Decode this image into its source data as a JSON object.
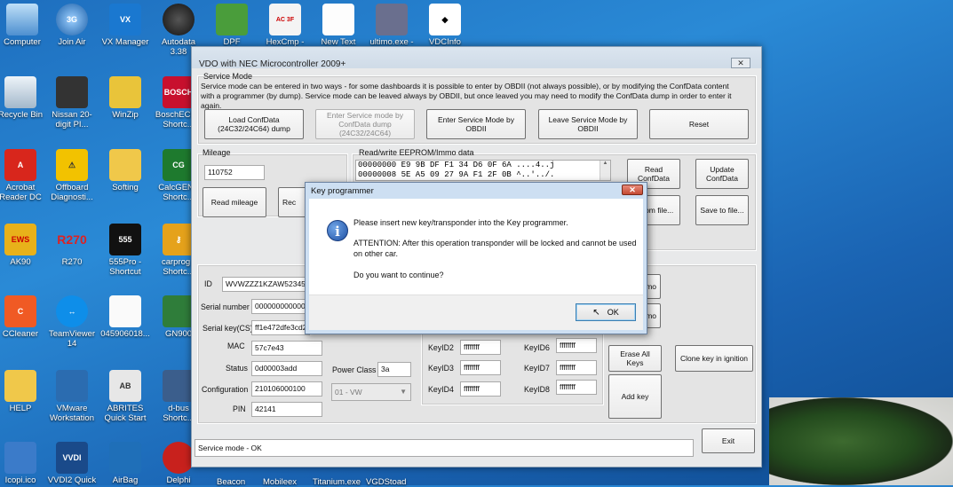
{
  "desktop": {
    "icons": [
      {
        "label": "Computer"
      },
      {
        "label": "Join Air"
      },
      {
        "label": "VX Manager"
      },
      {
        "label": "Autodata 3.38"
      },
      {
        "label": "DPF Remover"
      },
      {
        "label": "HexCmp -"
      },
      {
        "label": "New Text"
      },
      {
        "label": "ultimo.exe -"
      },
      {
        "label": "VDCInfo"
      },
      {
        "label": "Recycle Bin"
      },
      {
        "label": "Nissan 20-digit PI..."
      },
      {
        "label": "WinZip"
      },
      {
        "label": "BoschECU - Shortc..."
      },
      {
        "label": "Acrobat Reader DC"
      },
      {
        "label": "Offboard Diagnosti..."
      },
      {
        "label": "Softing"
      },
      {
        "label": "CalcGEN - Shortc..."
      },
      {
        "label": "AK90"
      },
      {
        "label": "R270"
      },
      {
        "label": "555Pro - Shortcut"
      },
      {
        "label": "carprog - Shortc..."
      },
      {
        "label": "CCleaner"
      },
      {
        "label": "TeamViewer 14"
      },
      {
        "label": "045906018..."
      },
      {
        "label": "GN900"
      },
      {
        "label": "HELP"
      },
      {
        "label": "VMware Workstation"
      },
      {
        "label": "ABRITES Quick Start"
      },
      {
        "label": "d-bus Shortc..."
      }
    ],
    "bottom_labels": [
      "Icopi.ico",
      "VVDI2 Quick",
      "AirBag",
      "Delphi",
      "Beacon",
      "Mobileex",
      "Titanium.exe",
      "VGDStoad"
    ]
  },
  "window": {
    "title": "VDO with NEC Microcontroller 2009+",
    "close": "✕",
    "service_mode": {
      "group_label": "Service Mode",
      "description": "Service mode can be entered in two ways - for some dashboards it is possible to enter by OBDII (not always possible), or by modifying the ConfData content with a programmer (by dump). Service mode can be leaved always by OBDII, but once leaved you may need to modify the ConfData dump in order to enter it again.",
      "btn_load": "Load ConfData (24C32/24C64) dump",
      "btn_enter_dump": "Enter Service mode by ConfData dump (24C32/24C64)",
      "btn_enter_obd": "Enter Service Mode by OBDII",
      "btn_leave_obd": "Leave Service Mode by OBDII",
      "btn_reset": "Reset"
    },
    "mileage": {
      "group_label": "Mileage",
      "value": "110752",
      "btn_read": "Read mileage",
      "btn_second": "Rec"
    },
    "eeprom": {
      "group_label": "Read/write EEPROM/Immo data",
      "lines": [
        "00000000 E9 9B DF F1 34 D6 0F 6A ....4..j",
        "00000008 5E A5 09 27 9A F1 2F 0B ^..'../."
      ],
      "btn_read_conf": "Read ConfData",
      "btn_update_conf": "Update ConfData",
      "btn_load_file": "d from file...",
      "btn_save_file": "Save to file..."
    },
    "immo": {
      "id_label": "ID",
      "id_value": "WVWZZZ1KZAW52345",
      "serial_label": "Serial number",
      "serial_value": "000000000000",
      "serialkey_label": "Serial key(CS)",
      "serialkey_value": "ff1e472dfe3cd2",
      "mac_label": "MAC",
      "mac_value": "57c7e43",
      "status_label": "Status",
      "status_value": "0d00003add",
      "config_label": "Configuration",
      "config_value": "210106000100",
      "pin_label": "PIN",
      "pin_value": "42141",
      "power_label": "Power Class",
      "power_value": "3a",
      "brand_value": "01 - VW",
      "side_btn_top": "mo",
      "side_btn_mid": "mo",
      "keys": [
        {
          "label": "KeyID2",
          "value": "ffffffff"
        },
        {
          "label": "KeyID3",
          "value": "ffffffff"
        },
        {
          "label": "KeyID4",
          "value": "ffffffff"
        },
        {
          "label": "KeyID6",
          "value": "ffffffff"
        },
        {
          "label": "KeyID7",
          "value": "ffffffff"
        },
        {
          "label": "KeyID8",
          "value": "ffffffff"
        }
      ],
      "btn_erase": "Erase All Keys",
      "btn_add": "Add key",
      "btn_clone": "Clone key in ignition"
    },
    "status_bar": "Service mode - OK",
    "btn_exit": "Exit"
  },
  "dialog": {
    "title": "Key programmer",
    "close": "✕",
    "icon": "info-icon",
    "line1": "Please insert new key/transponder into the Key programmer.",
    "line2": "ATTENTION: After this operation transponder will be locked and cannot be used on other car.",
    "line3": "Do you want to continue?",
    "ok": "OK"
  }
}
